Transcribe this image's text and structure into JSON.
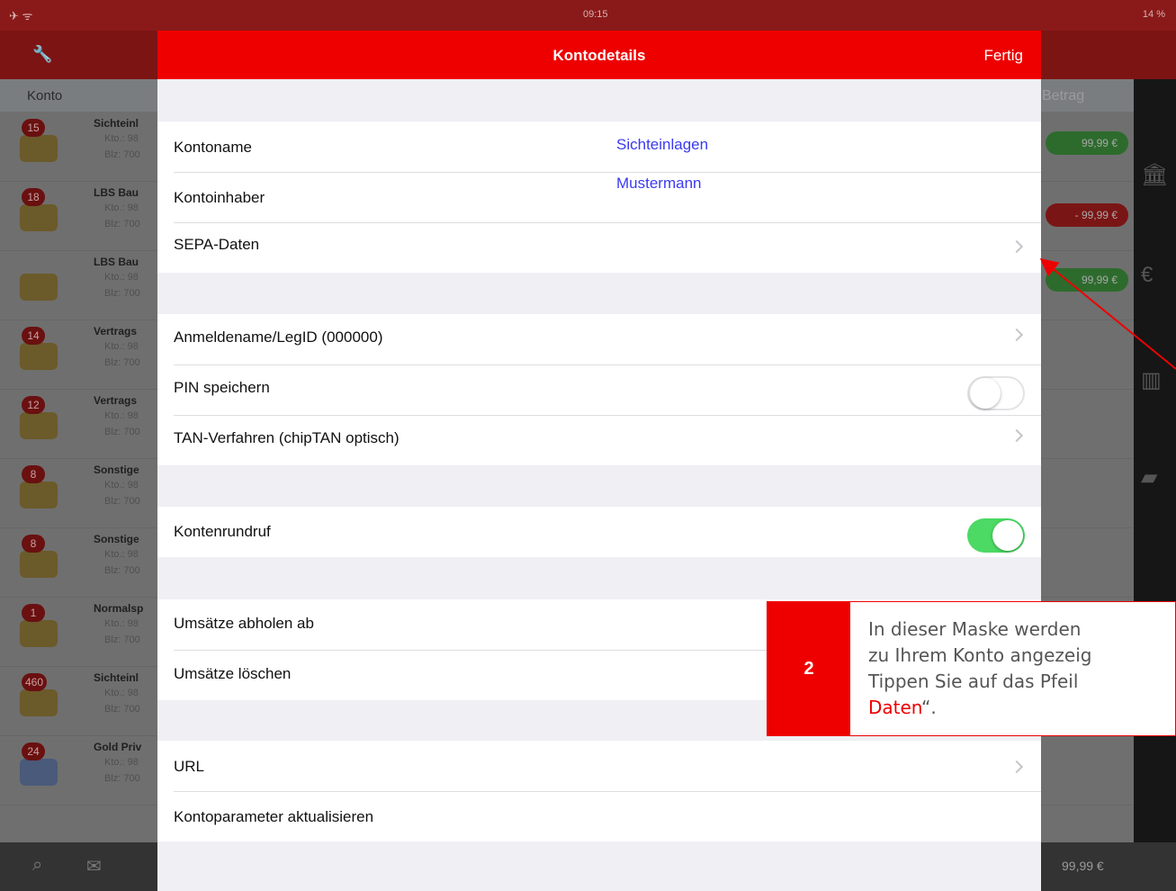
{
  "status": {
    "time": "09:15",
    "battery": "14 %"
  },
  "background": {
    "list_header": {
      "konto": "Konto",
      "betrag": "Betrag"
    },
    "accounts": [
      {
        "badge": "15",
        "name": "Sichteinl",
        "line2": "Kto.: 98",
        "line3": "Blz: 700"
      },
      {
        "badge": "18",
        "name": "LBS Bau",
        "line2": "Kto.: 98",
        "line3": "Blz: 700"
      },
      {
        "badge": "",
        "name": "LBS Bau",
        "line2": "Kto.: 98",
        "line3": "Blz: 700"
      },
      {
        "badge": "14",
        "name": "Vertrags",
        "line2": "Kto.: 98",
        "line3": "Blz: 700"
      },
      {
        "badge": "12",
        "name": "Vertrags",
        "line2": "Kto.: 98",
        "line3": "Blz: 700"
      },
      {
        "badge": "8",
        "name": "Sonstige",
        "line2": "Kto.: 98",
        "line3": "Blz: 700"
      },
      {
        "badge": "8",
        "name": "Sonstige",
        "line2": "Kto.: 98",
        "line3": "Blz: 700"
      },
      {
        "badge": "1",
        "name": "Normalsp",
        "line2": "Kto.: 98",
        "line3": "Blz: 700"
      },
      {
        "badge": "460",
        "name": "Sichteinl",
        "line2": "Kto.: 98",
        "line3": "Blz: 700"
      },
      {
        "badge": "24",
        "name": "Gold Priv",
        "line2": "Kto.: 98",
        "line3": "Blz: 700"
      }
    ],
    "amounts": [
      "99,99 €",
      "- 99,99 €",
      "99,99 €"
    ],
    "bottom_amount": "99,99 €"
  },
  "modal": {
    "title": "Kontodetails",
    "done": "Fertig",
    "group1": [
      {
        "label": "Kontoname",
        "value": "Sichteinlagen"
      },
      {
        "label": "Kontoinhaber",
        "value": "Mustermann"
      },
      {
        "label": "SEPA-Daten"
      }
    ],
    "group2": [
      {
        "label": "Anmeldename/LegID (000000)"
      },
      {
        "label": "PIN speichern",
        "toggle": false
      },
      {
        "label": "TAN-Verfahren (chipTAN optisch)"
      }
    ],
    "group3": [
      {
        "label": "Kontenrundruf",
        "toggle": true
      }
    ],
    "group4": [
      {
        "label": "Umsätze abholen ab"
      },
      {
        "label": "Umsätze löschen"
      }
    ],
    "group5": [
      {
        "label": "URL"
      },
      {
        "label": "Kontoparameter aktualisieren"
      }
    ]
  },
  "callout": {
    "number": "2",
    "line1": "In dieser Maske werden",
    "line2": "zu Ihrem Konto angezeig",
    "line3": "Tippen Sie auf das Pfeil",
    "line4_highlight": "Daten",
    "line4_rest": "“."
  },
  "colors": {
    "accent": "#ee0000",
    "link": "#3a3af2",
    "toggle_on": "#4cd964"
  }
}
